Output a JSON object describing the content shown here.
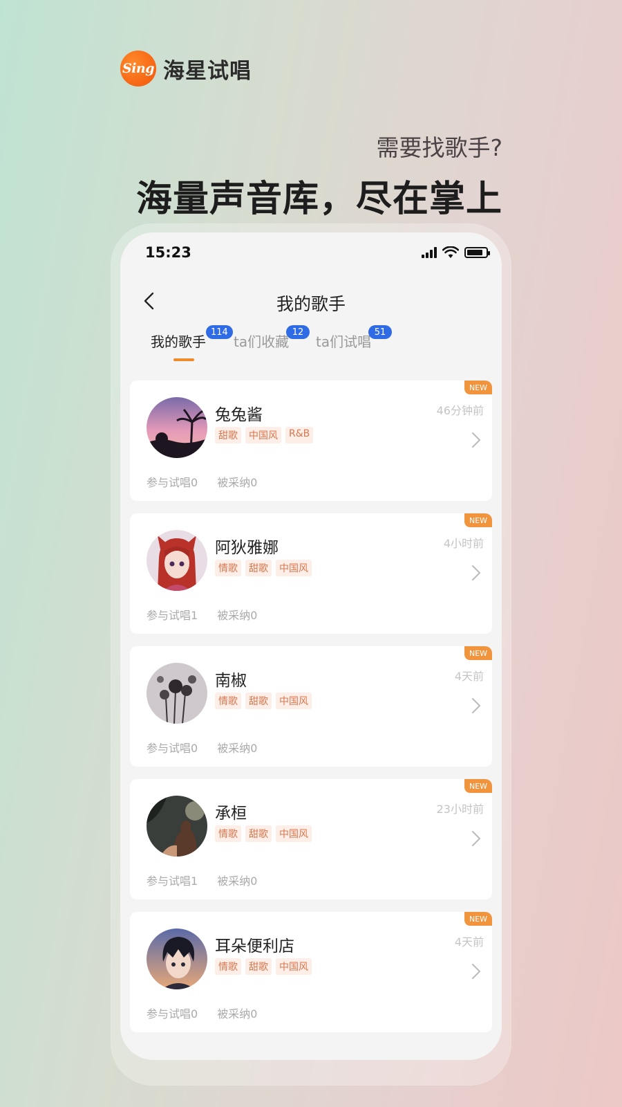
{
  "brand": {
    "logo_text": "Sing",
    "name": "海星试唱"
  },
  "promo": {
    "subtitle": "需要找歌手?",
    "title": "海量声音库，尽在掌上"
  },
  "status_bar": {
    "time": "15:23",
    "battery_level": 0.85
  },
  "nav": {
    "title": "我的歌手",
    "back_icon": "chevron-left-icon"
  },
  "tabs": [
    {
      "label": "我的歌手",
      "count": "114",
      "active": true
    },
    {
      "label": "ta们收藏",
      "count": "12",
      "active": false
    },
    {
      "label": "ta们试唱",
      "count": "51",
      "active": false
    }
  ],
  "singers": [
    {
      "name": "兔兔酱",
      "time": "46分钟前",
      "new_label": "NEW",
      "tags": [
        "甜歌",
        "中国风",
        "R&B"
      ],
      "participated": "参与试唱0",
      "adopted": "被采纳0",
      "avatar": "sunset-palm-avatar"
    },
    {
      "name": "阿狄雅娜",
      "time": "4小时前",
      "new_label": "NEW",
      "tags": [
        "情歌",
        "甜歌",
        "中国风"
      ],
      "participated": "参与试唱1",
      "adopted": "被采纳0",
      "avatar": "anime-girl-avatar"
    },
    {
      "name": "南椒",
      "time": "4天前",
      "new_label": "NEW",
      "tags": [
        "情歌",
        "甜歌",
        "中国风"
      ],
      "participated": "参与试唱0",
      "adopted": "被采纳0",
      "avatar": "dried-flowers-avatar"
    },
    {
      "name": "承桓",
      "time": "23小时前",
      "new_label": "NEW",
      "tags": [
        "情歌",
        "甜歌",
        "中国风"
      ],
      "participated": "参与试唱1",
      "adopted": "被采纳0",
      "avatar": "silhouette-avatar"
    },
    {
      "name": "耳朵便利店",
      "time": "4天前",
      "new_label": "NEW",
      "tags": [
        "情歌",
        "甜歌",
        "中国风"
      ],
      "participated": "参与试唱0",
      "adopted": "被采纳0",
      "avatar": "anime-boy-avatar"
    }
  ],
  "colors": {
    "accent": "#ee8a2c",
    "badge": "#2f6be4",
    "tag_bg": "#fdeee8",
    "tag_text": "#d9774e"
  }
}
